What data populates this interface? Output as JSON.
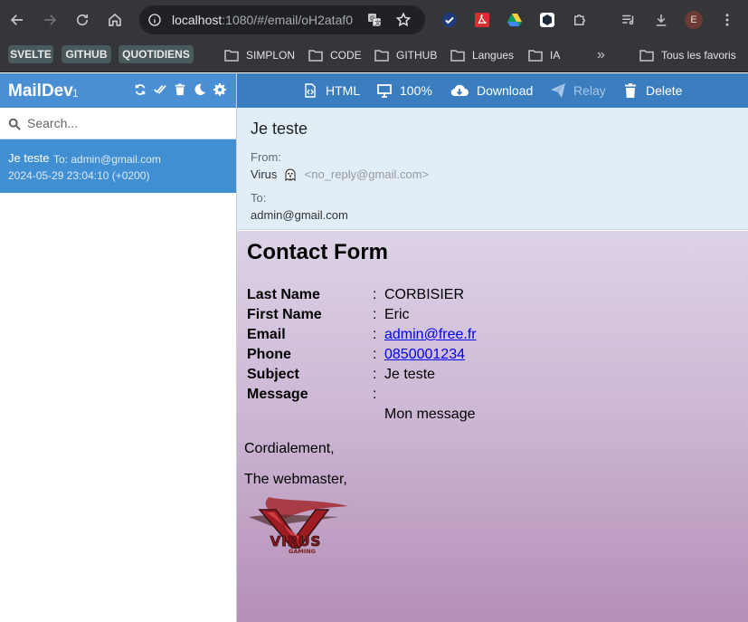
{
  "browser": {
    "url_host": "localhost",
    "url_rest": ":1080/#/email/oH2ataf0",
    "avatar_letter": "E"
  },
  "bookmarks": {
    "chips": [
      "SVELTE",
      "GITHUB",
      "QUOTIDIENS"
    ],
    "folders": [
      "SIMPLON",
      "CODE",
      "GITHUB",
      "Langues",
      "IA"
    ],
    "more": "»",
    "all_bookmarks": "Tous les favoris"
  },
  "sidebar": {
    "brand": "MailDev",
    "count": "1",
    "search_placeholder": "Search...",
    "emails": [
      {
        "subject": "Je teste",
        "to": "To: admin@gmail.com",
        "date": "2024-05-29 23:04:10 (+0200)"
      }
    ]
  },
  "toolbar": {
    "html": "HTML",
    "zoom": "100%",
    "download": "Download",
    "relay": "Relay",
    "delete": "Delete"
  },
  "message": {
    "subject": "Je teste",
    "from_label": "From:",
    "from_name": "Virus",
    "from_address": "<no_reply@gmail.com>",
    "to_label": "To:",
    "to_value": "admin@gmail.com"
  },
  "body": {
    "title": "Contact Form",
    "fields": [
      {
        "label": "Last Name",
        "value": "CORBISIER"
      },
      {
        "label": "First Name",
        "value": "Eric"
      },
      {
        "label": "Email",
        "value": "admin@free.fr"
      },
      {
        "label": "Phone",
        "value": "0850001234"
      },
      {
        "label": "Subject",
        "value": "Je teste"
      },
      {
        "label": "Message",
        "value": ""
      }
    ],
    "colon": ":",
    "message_text": "Mon message",
    "closing": "Cordialement,",
    "signoff": "The webmaster,",
    "logo_text": "VIRUS",
    "logo_subtext": "GAMING"
  },
  "colors": {
    "maildev_blue": "#4a8fd3",
    "toolbar_blue": "#3a7ec0",
    "header_panel": "#e1eef8"
  }
}
